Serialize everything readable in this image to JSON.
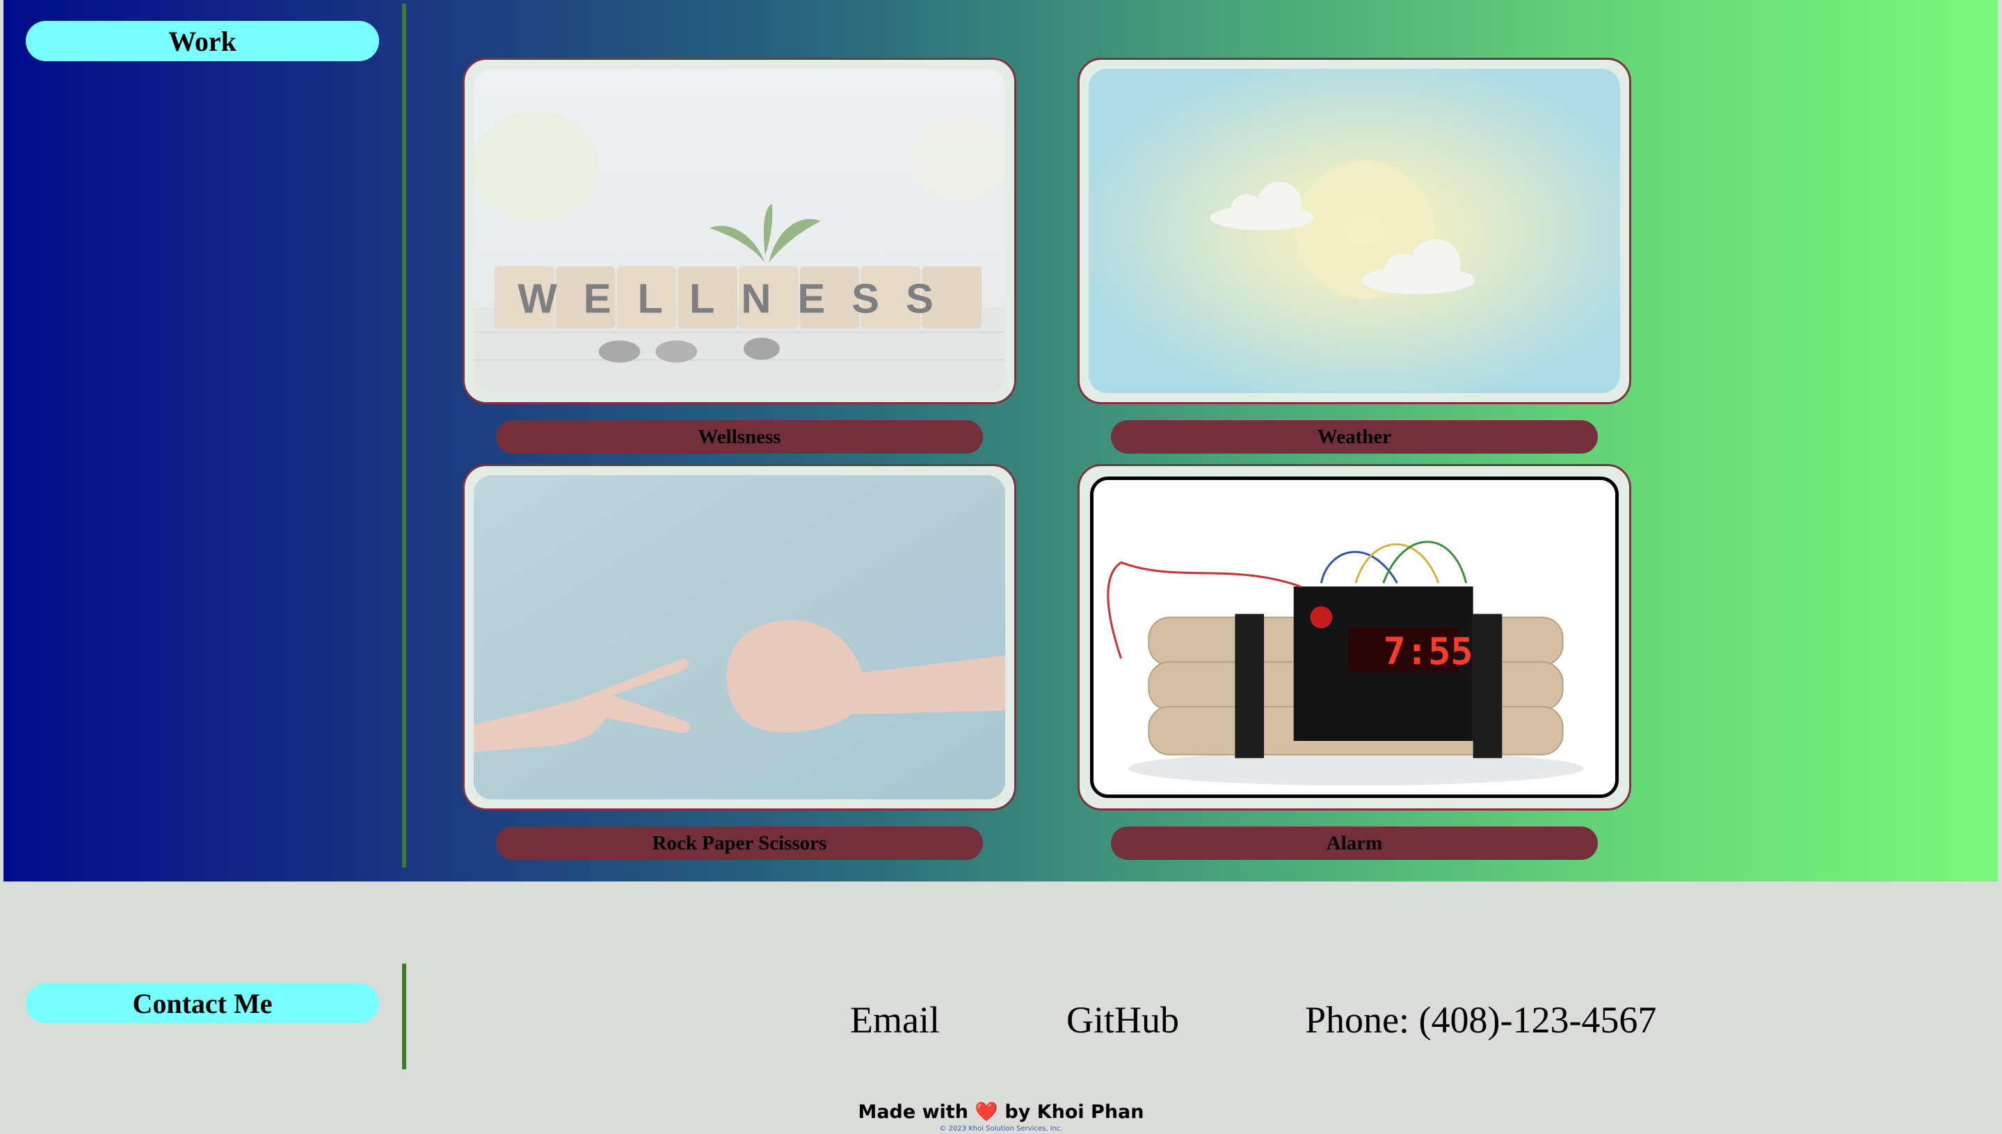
{
  "work": {
    "heading": "Work",
    "projects": [
      {
        "title": "Wellsness",
        "image_word": "WELLNESS"
      },
      {
        "title": "Weather"
      },
      {
        "title": "Rock Paper Scissors"
      },
      {
        "title": "Alarm",
        "clock_display": "7:55"
      }
    ]
  },
  "contact": {
    "heading": "Contact Me",
    "email": "Email",
    "github": "GitHub",
    "phone": "Phone: (408)-123-4567"
  },
  "footer": {
    "made_prefix": "Made with",
    "heart": "❤️",
    "made_suffix": "by Khoi Phan",
    "copyright": "© 2023 Khoi Solution Services, Inc."
  },
  "colors": {
    "pill_cyan": "#79ffff",
    "label_maroon": "#73303c",
    "divider_green": "#3a7a2a",
    "footer_bg": "#d9dcd8"
  }
}
